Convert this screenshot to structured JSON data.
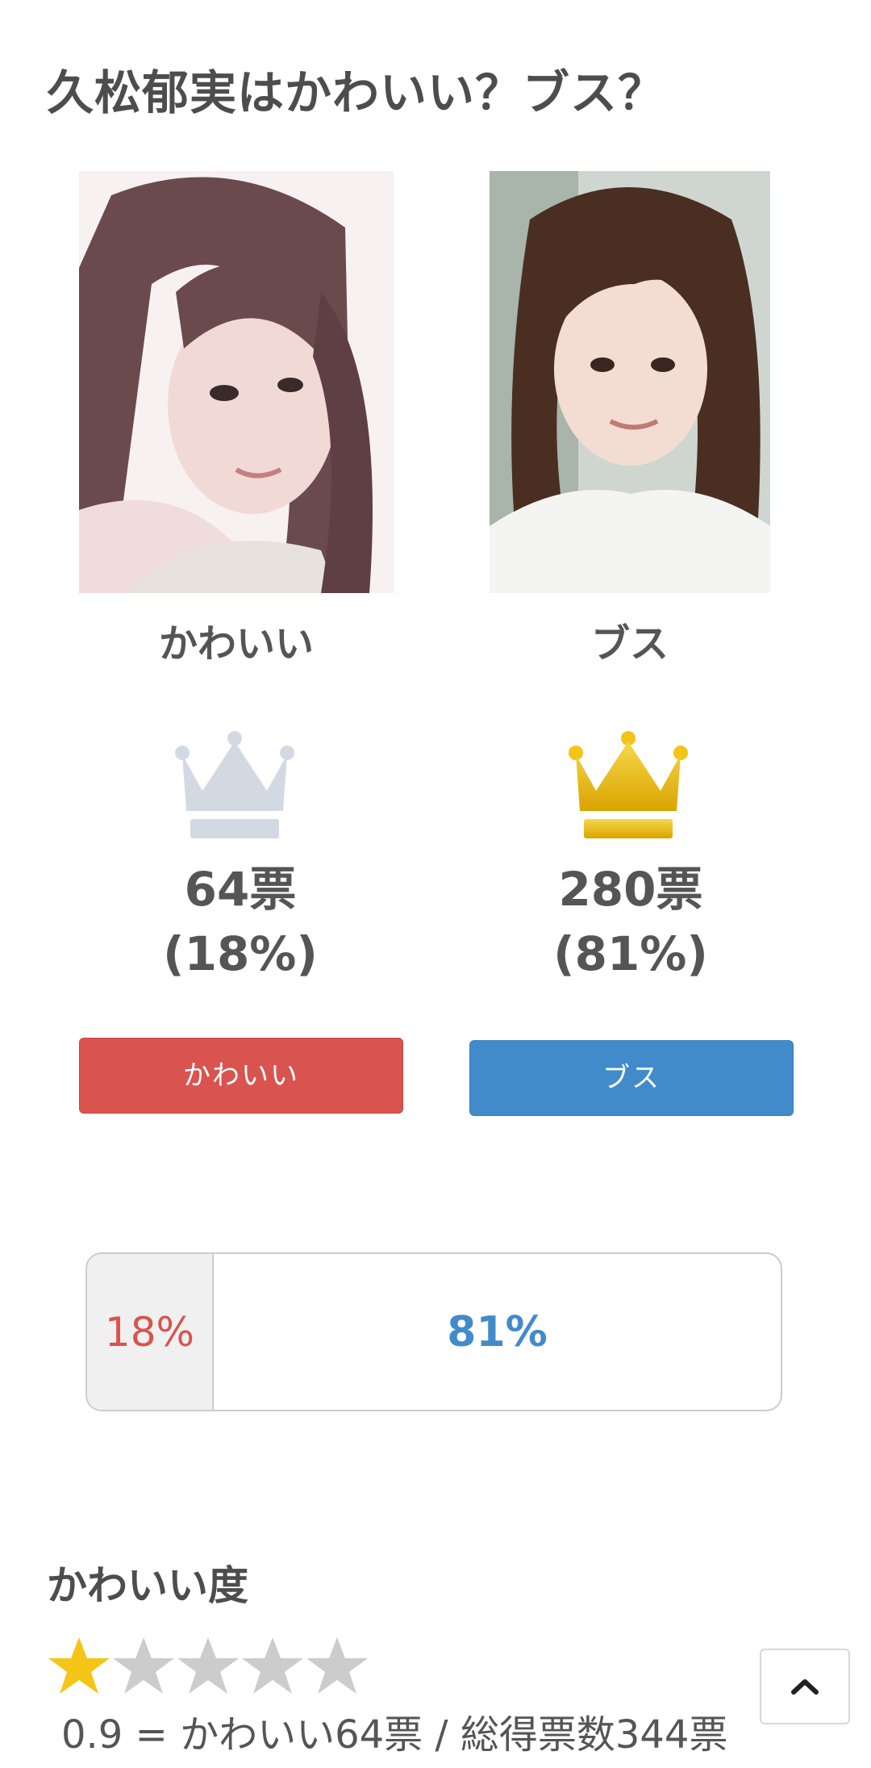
{
  "page": {
    "title": "久松郁実はかわいい？ブス？"
  },
  "options": [
    {
      "label": "かわいい",
      "votes": "64票",
      "percent": "(18%)",
      "button_label": "かわいい",
      "crown": "silver-crown-icon"
    },
    {
      "label": "ブス",
      "votes": "280票",
      "percent": "(81%)",
      "button_label": "ブス",
      "crown": "gold-crown-icon"
    }
  ],
  "ratio_bar": {
    "kawaii_percent": "18%",
    "busu_percent": "81%",
    "kawaii_fraction": 0.18
  },
  "rating": {
    "heading": "かわいい度",
    "stars_filled": 1,
    "stars_total": 5,
    "formula": "0.9 = かわいい64票 / 総得票数344票"
  },
  "colors": {
    "kawaii_accent": "#d9534f",
    "busu_accent": "#428bca",
    "star_filled": "#f5c518",
    "star_empty": "#cccccc"
  },
  "icons": {
    "scroll_top": "chevron-up-icon",
    "star": "star-icon"
  }
}
